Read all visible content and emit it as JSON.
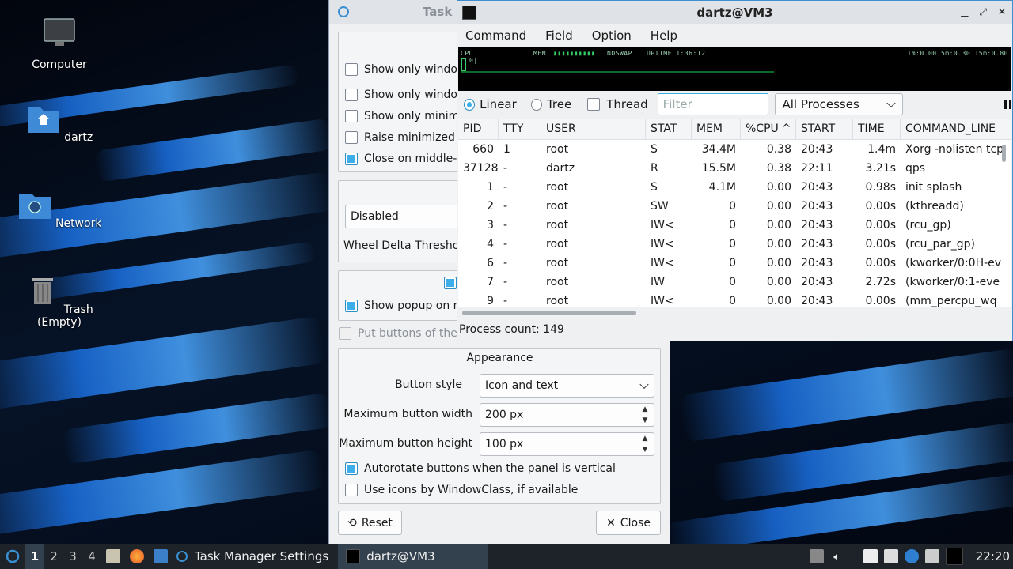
{
  "desktop": {
    "icons": [
      {
        "label": "Computer",
        "icon": "monitor-icon"
      },
      {
        "label": "dartz",
        "icon": "home-folder-icon"
      },
      {
        "label": "Network",
        "icon": "network-folder-icon"
      },
      {
        "label": "Trash (Empty)",
        "icon": "trash-icon"
      }
    ]
  },
  "task_settings": {
    "title": "Task",
    "checks": [
      {
        "label": "Show only windo",
        "checked": false
      },
      {
        "label": "Show only windo",
        "checked": false
      },
      {
        "label": "Show only minimi",
        "checked": false
      },
      {
        "label": "Raise minimized v",
        "checked": false
      },
      {
        "label": "Close on middle-c",
        "checked": true
      }
    ],
    "disabled_combo": "Disabled",
    "wheel_label": "Wheel Delta Thresho",
    "popup_check": "Show popup on m",
    "put_buttons": "Put buttons of the",
    "appearance": {
      "heading": "Appearance",
      "button_style_label": "Button style",
      "button_style_value": "Icon and text",
      "max_width_label": "Maximum button width",
      "max_width_value": "200 px",
      "max_height_label": "Maximum button height",
      "max_height_value": "100 px",
      "autorotate": "Autorotate buttons when the panel is vertical",
      "use_icons": "Use icons by WindowClass, if available"
    },
    "reset_label": "Reset",
    "close_label": "Close"
  },
  "qps": {
    "title": "dartz@VM3",
    "menu": [
      "Command",
      "Field",
      "Option",
      "Help"
    ],
    "graph": {
      "cpu": "CPU",
      "mem": "MEM",
      "noswap": "NOSWAP",
      "uptime": "UPTIME 1:36:12",
      "load": "1m:0.00 5m:0.30 15m:0.80",
      "zero": "0|"
    },
    "view_modes": {
      "linear": "Linear",
      "tree": "Tree",
      "thread": "Thread"
    },
    "filter_placeholder": "Filter",
    "process_filter": "All Processes",
    "columns": [
      "PID",
      "TTY",
      "USER",
      "STAT",
      "MEM",
      "%CPU",
      "START",
      "TIME",
      "COMMAND_LINE"
    ],
    "rows": [
      [
        "660",
        "1",
        "root",
        "S",
        "34.4M",
        "0.38",
        "20:43",
        "1.4m",
        "Xorg -nolisten tcp"
      ],
      [
        "37128",
        "-",
        "dartz",
        "R",
        "15.5M",
        "0.38",
        "22:11",
        "3.21s",
        "qps"
      ],
      [
        "1",
        "-",
        "root",
        "S",
        "4.1M",
        "0.00",
        "20:43",
        "0.98s",
        "init splash"
      ],
      [
        "2",
        "-",
        "root",
        "SW",
        "0",
        "0.00",
        "20:43",
        "0.00s",
        "(kthreadd)"
      ],
      [
        "3",
        "-",
        "root",
        "IW<",
        "0",
        "0.00",
        "20:43",
        "0.00s",
        "(rcu_gp)"
      ],
      [
        "4",
        "-",
        "root",
        "IW<",
        "0",
        "0.00",
        "20:43",
        "0.00s",
        "(rcu_par_gp)"
      ],
      [
        "6",
        "-",
        "root",
        "IW<",
        "0",
        "0.00",
        "20:43",
        "0.00s",
        "(kworker/0:0H-ev"
      ],
      [
        "7",
        "-",
        "root",
        "IW",
        "0",
        "0.00",
        "20:43",
        "2.72s",
        "(kworker/0:1-eve"
      ],
      [
        "9",
        "-",
        "root",
        "IW<",
        "0",
        "0.00",
        "20:43",
        "0.00s",
        "(mm_percpu_wq"
      ]
    ],
    "status": "Process count: 149"
  },
  "taskbar": {
    "workspaces": [
      "1",
      "2",
      "3",
      "4"
    ],
    "task1": "Task Manager Settings",
    "task2": "dartz@VM3",
    "clock": "22:20"
  }
}
